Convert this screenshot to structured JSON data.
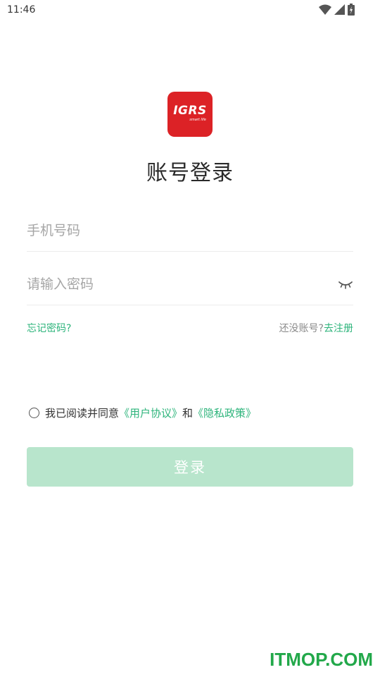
{
  "status_bar": {
    "time": "11:46",
    "icons": [
      "wifi-icon",
      "cellular-signal-icon",
      "battery-charging-icon"
    ]
  },
  "logo": {
    "text": "IGRS",
    "subtext": "smart life",
    "bg_color": "#dc2226"
  },
  "page_title": "账号登录",
  "form": {
    "phone_placeholder": "手机号码",
    "phone_value": "",
    "password_placeholder": "请输入密码",
    "password_value": "",
    "password_visibility_icon": "eye-closed-icon"
  },
  "links": {
    "forgot_password": "忘记密码?",
    "no_account": "还没账号?",
    "register": "去注册"
  },
  "agreement": {
    "checked": false,
    "prefix": "我已阅读并同意",
    "user_agreement": "《用户协议》",
    "conjunction": "和",
    "privacy_policy": "《隐私政策》"
  },
  "login_button": {
    "label": "登录",
    "enabled": false
  },
  "watermark": "ITMOP.COM",
  "colors": {
    "accent": "#2db47b",
    "button_disabled": "#b8e5cc",
    "watermark": "#22a84a"
  }
}
